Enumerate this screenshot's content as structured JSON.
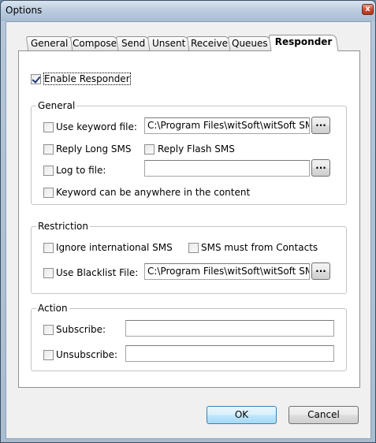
{
  "window": {
    "title": "Options",
    "close_glyph": "x"
  },
  "tabs": [
    "General",
    "Compose",
    "Send",
    "Unsent",
    "Receive",
    "Queues",
    "Responder"
  ],
  "active_tab": "Responder",
  "enable_responder": {
    "label": "Enable Responder",
    "checked": true
  },
  "general": {
    "title": "General",
    "use_keyword_file": {
      "label": "Use keyword file:",
      "checked": false,
      "value": "C:\\Program Files\\witSoft\\witSoft SMS"
    },
    "reply_long_sms": {
      "label": "Reply Long SMS",
      "checked": false
    },
    "reply_flash_sms": {
      "label": "Reply Flash SMS",
      "checked": false
    },
    "log_to_file": {
      "label": "Log to file:",
      "checked": false,
      "value": ""
    },
    "keyword_anywhere": {
      "label": "Keyword can be anywhere in the content",
      "checked": false
    }
  },
  "restriction": {
    "title": "Restriction",
    "ignore_international": {
      "label": "Ignore international SMS",
      "checked": false
    },
    "must_from_contacts": {
      "label": "SMS must from Contacts",
      "checked": false
    },
    "use_blacklist": {
      "label": "Use Blacklist File:",
      "checked": false,
      "value": "C:\\Program Files\\witSoft\\witSoft SMS"
    }
  },
  "action": {
    "title": "Action",
    "subscribe": {
      "label": "Subscribe:",
      "checked": false,
      "value": ""
    },
    "unsubscribe": {
      "label": "Unsubscribe:",
      "checked": false,
      "value": ""
    }
  },
  "browse_label": "...",
  "buttons": {
    "ok": "OK",
    "cancel": "Cancel"
  }
}
